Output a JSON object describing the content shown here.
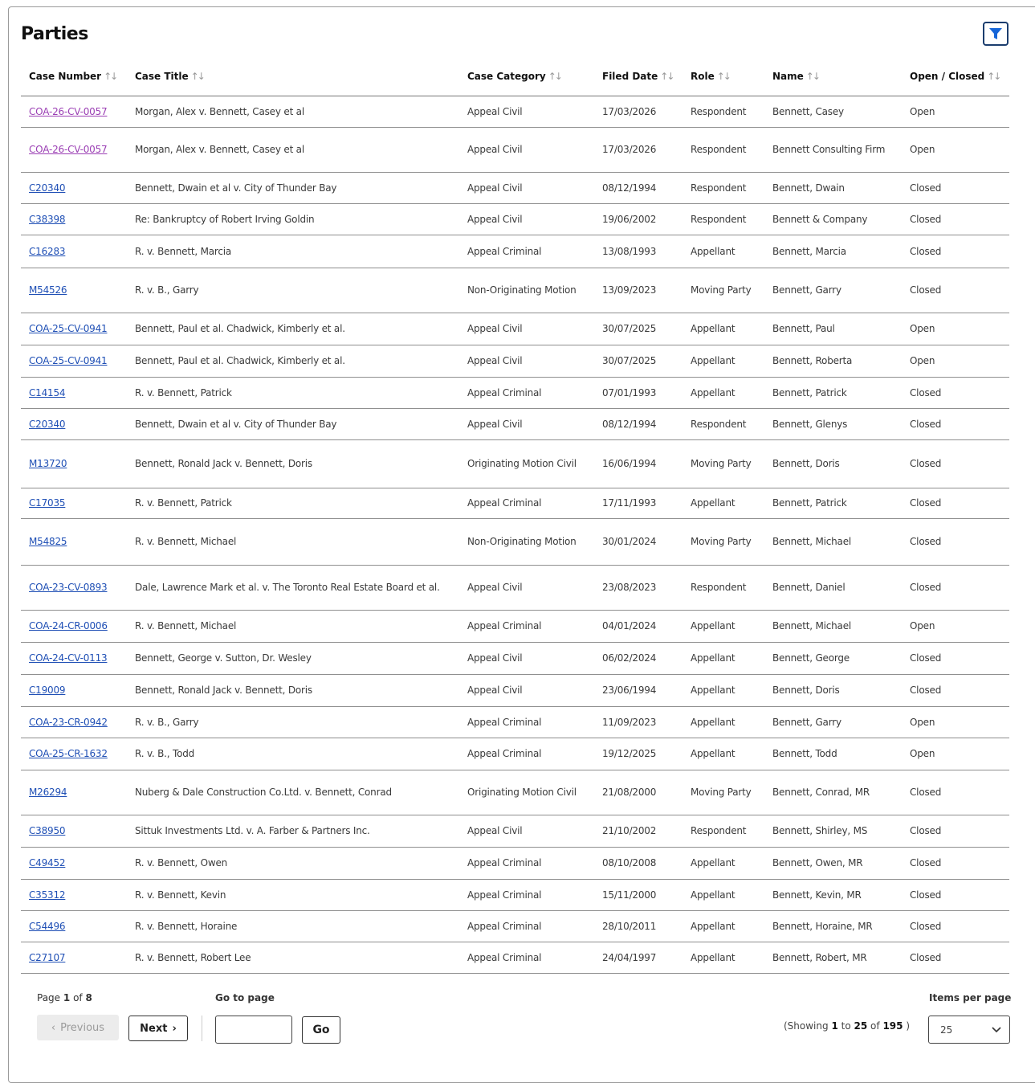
{
  "title": "Parties",
  "columns": [
    {
      "label": "Case Number",
      "sortable": true
    },
    {
      "label": "Case Title",
      "sortable": true
    },
    {
      "label": "Case Category",
      "sortable": true
    },
    {
      "label": "Filed Date",
      "sortable": true
    },
    {
      "label": "Role",
      "sortable": true
    },
    {
      "label": "Name",
      "sortable": true
    },
    {
      "label": "Open / Closed",
      "sortable": true
    }
  ],
  "sort_icon": "sort-up-down-icon",
  "rows": [
    {
      "case_number": "COA-26-CV-0057",
      "visited": true,
      "title": "Morgan, Alex v. Bennett, Casey et al",
      "category": "Appeal Civil",
      "filed": "17/03/2026",
      "role": "Respondent",
      "name": "Bennett, Casey",
      "status": "Open"
    },
    {
      "case_number": "COA-26-CV-0057",
      "visited": true,
      "title": "Morgan, Alex v. Bennett, Casey et al",
      "category": "Appeal Civil",
      "filed": "17/03/2026",
      "role": "Respondent",
      "name": "Bennett Consulting Firm",
      "status": "Open"
    },
    {
      "case_number": "C20340",
      "title": "Bennett, Dwain et al v. City of Thunder Bay",
      "category": "Appeal Civil",
      "filed": "08/12/1994",
      "role": "Respondent",
      "name": "Bennett, Dwain",
      "status": "Closed"
    },
    {
      "case_number": "C38398",
      "title": "Re: Bankruptcy of Robert Irving Goldin",
      "category": "Appeal Civil",
      "filed": "19/06/2002",
      "role": "Respondent",
      "name": "Bennett & Company",
      "status": "Closed"
    },
    {
      "case_number": "C16283",
      "title": "R. v. Bennett, Marcia",
      "category": "Appeal Criminal",
      "filed": "13/08/1993",
      "role": "Appellant",
      "name": "Bennett, Marcia",
      "status": "Closed"
    },
    {
      "case_number": "M54526",
      "title": "R. v. B., Garry",
      "category": "Non-Originating Motion",
      "filed": "13/09/2023",
      "role": "Moving Party",
      "name": "Bennett, Garry",
      "status": "Closed"
    },
    {
      "case_number": "COA-25-CV-0941",
      "title": "Bennett, Paul et al. Chadwick, Kimberly et al.",
      "category": "Appeal Civil",
      "filed": "30/07/2025",
      "role": "Appellant",
      "name": "Bennett, Paul",
      "status": "Open"
    },
    {
      "case_number": "COA-25-CV-0941",
      "title": "Bennett, Paul et al. Chadwick, Kimberly et al.",
      "category": "Appeal Civil",
      "filed": "30/07/2025",
      "role": "Appellant",
      "name": "Bennett, Roberta",
      "status": "Open"
    },
    {
      "case_number": "C14154",
      "title": "R. v. Bennett, Patrick",
      "category": "Appeal Criminal",
      "filed": "07/01/1993",
      "role": "Appellant",
      "name": "Bennett, Patrick",
      "status": "Closed"
    },
    {
      "case_number": "C20340",
      "title": "Bennett, Dwain et al v. City of Thunder Bay",
      "category": "Appeal Civil",
      "filed": "08/12/1994",
      "role": "Respondent",
      "name": "Bennett, Glenys",
      "status": "Closed"
    },
    {
      "case_number": "M13720",
      "title": "Bennett, Ronald Jack v. Bennett, Doris",
      "category": "Originating Motion Civil",
      "filed": "16/06/1994",
      "role": "Moving Party",
      "name": "Bennett, Doris",
      "status": "Closed"
    },
    {
      "case_number": "C17035",
      "title": "R. v. Bennett, Patrick",
      "category": "Appeal Criminal",
      "filed": "17/11/1993",
      "role": "Appellant",
      "name": "Bennett, Patrick",
      "status": "Closed"
    },
    {
      "case_number": "M54825",
      "title": "R. v. Bennett, Michael",
      "category": "Non-Originating Motion",
      "filed": "30/01/2024",
      "role": "Moving Party",
      "name": "Bennett, Michael",
      "status": "Closed"
    },
    {
      "case_number": "COA-23-CV-0893",
      "title": "Dale, Lawrence Mark et al. v. The Toronto Real Estate Board et al.",
      "category": "Appeal Civil",
      "filed": "23/08/2023",
      "role": "Respondent",
      "name": "Bennett, Daniel",
      "status": "Closed"
    },
    {
      "case_number": "COA-24-CR-0006",
      "title": "R. v. Bennett, Michael",
      "category": "Appeal Criminal",
      "filed": "04/01/2024",
      "role": "Appellant",
      "name": "Bennett, Michael",
      "status": "Open"
    },
    {
      "case_number": "COA-24-CV-0113",
      "title": "Bennett, George v. Sutton, Dr. Wesley",
      "category": "Appeal Civil",
      "filed": "06/02/2024",
      "role": "Appellant",
      "name": "Bennett, George",
      "status": "Closed"
    },
    {
      "case_number": "C19009",
      "title": "Bennett, Ronald Jack v. Bennett, Doris",
      "category": "Appeal Civil",
      "filed": "23/06/1994",
      "role": "Appellant",
      "name": "Bennett, Doris",
      "status": "Closed"
    },
    {
      "case_number": "COA-23-CR-0942",
      "title": "R. v. B., Garry",
      "category": "Appeal Criminal",
      "filed": "11/09/2023",
      "role": "Appellant",
      "name": "Bennett, Garry",
      "status": "Open"
    },
    {
      "case_number": "COA-25-CR-1632",
      "title": "R. v. B., Todd",
      "category": "Appeal Criminal",
      "filed": "19/12/2025",
      "role": "Appellant",
      "name": "Bennett, Todd",
      "status": "Open"
    },
    {
      "case_number": "M26294",
      "title": "Nuberg & Dale Construction Co.Ltd. v. Bennett, Conrad",
      "category": "Originating Motion Civil",
      "filed": "21/08/2000",
      "role": "Moving Party",
      "name": "Bennett, Conrad, MR",
      "status": "Closed"
    },
    {
      "case_number": "C38950",
      "title": "Sittuk Investments Ltd. v. A. Farber & Partners Inc.",
      "category": "Appeal Civil",
      "filed": "21/10/2002",
      "role": "Respondent",
      "name": "Bennett, Shirley, MS",
      "status": "Closed"
    },
    {
      "case_number": "C49452",
      "title": "R. v. Bennett, Owen",
      "category": "Appeal Criminal",
      "filed": "08/10/2008",
      "role": "Appellant",
      "name": "Bennett, Owen, MR",
      "status": "Closed"
    },
    {
      "case_number": "C35312",
      "title": "R. v. Bennett, Kevin",
      "category": "Appeal Criminal",
      "filed": "15/11/2000",
      "role": "Appellant",
      "name": "Bennett, Kevin, MR",
      "status": "Closed"
    },
    {
      "case_number": "C54496",
      "title": "R. v. Bennett, Horaine",
      "category": "Appeal Criminal",
      "filed": "28/10/2011",
      "role": "Appellant",
      "name": "Bennett, Horaine, MR",
      "status": "Closed"
    },
    {
      "case_number": "C27107",
      "title": "R. v. Bennett, Robert Lee",
      "category": "Appeal Criminal",
      "filed": "24/04/1997",
      "role": "Appellant",
      "name": "Bennett, Robert, MR",
      "status": "Closed"
    }
  ],
  "pagination": {
    "page_word": "Page",
    "current_page": "1",
    "of_word": "of",
    "total_pages": "8",
    "previous_label": "Previous",
    "next_label": "Next",
    "go_to_page_label": "Go to page",
    "page_input_value": "",
    "go_label": "Go",
    "showing_prefix": "(Showing",
    "showing_from": "1",
    "showing_to_word": "to",
    "showing_to": "25",
    "showing_of_word": "of",
    "showing_total": "195",
    "showing_suffix": ")",
    "items_per_page_label": "Items per page",
    "items_per_page_value": "25"
  },
  "colors": {
    "link": "#1f4fb5",
    "visited_link": "#9b3fb4",
    "filter_icon": "#1565d8",
    "filter_border": "#1b3d6e"
  },
  "icons": {
    "filter": "filter-funnel-icon",
    "previous": "chevron-left-icon",
    "next": "chevron-right-icon",
    "dropdown": "chevron-down-icon"
  }
}
